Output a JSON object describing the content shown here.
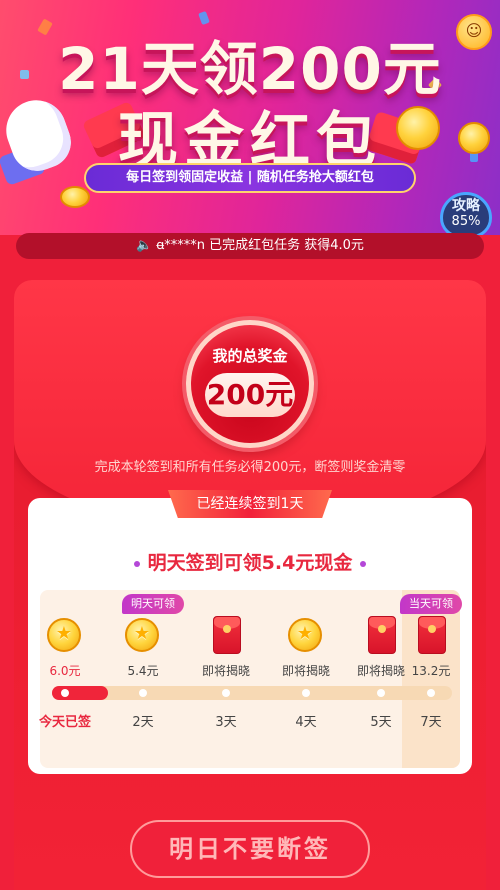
{
  "banner": {
    "title_line1": "21天领200元",
    "title_line2": "现金红包",
    "subtitle": "每日签到领固定收益 | 随机任务抢大额红包",
    "strategy_label": "攻略",
    "strategy_percent": "85%",
    "colors": {
      "start": "#ff4d6d",
      "mid": "#e0259a",
      "end": "#8c2fc8"
    }
  },
  "notice": {
    "icon": "speaker-icon",
    "text": "ꬰ*****n 已完成红包任务 获得4.0元"
  },
  "envelope": {
    "seal_label": "我的总奖金",
    "seal_amount": "200元",
    "rule": "完成本轮签到和所有任务必得200元，断签则奖金清零"
  },
  "card": {
    "streak_banner": "已经连续签到1天",
    "tomorrow_text": "明天签到可领5.4元现金",
    "tag_tomorrow": "明天可领",
    "tag_today": "当天可领",
    "days": [
      {
        "icon": "coin-icon",
        "amount": "6.0元",
        "label": "今天已签",
        "is_today": true
      },
      {
        "icon": "coin-icon",
        "amount": "5.4元",
        "label": "2天",
        "is_today": false
      },
      {
        "icon": "red-packet-icon",
        "amount": "即将揭晓",
        "label": "3天",
        "is_today": false
      },
      {
        "icon": "coin-icon",
        "amount": "即将揭晓",
        "label": "4天",
        "is_today": false
      },
      {
        "icon": "red-packet-icon",
        "amount": "即将揭晓",
        "label": "5天",
        "is_today": false
      },
      {
        "icon": "red-packet-coins-icon",
        "amount": "13.2元",
        "label": "7天",
        "is_today": false
      }
    ],
    "progress_fraction": 0.14
  },
  "cta": {
    "label": "明日不要断签"
  },
  "theme": {
    "accent_red": "#f0213a",
    "gold": "#ffd53d",
    "purple": "#b447d8"
  }
}
